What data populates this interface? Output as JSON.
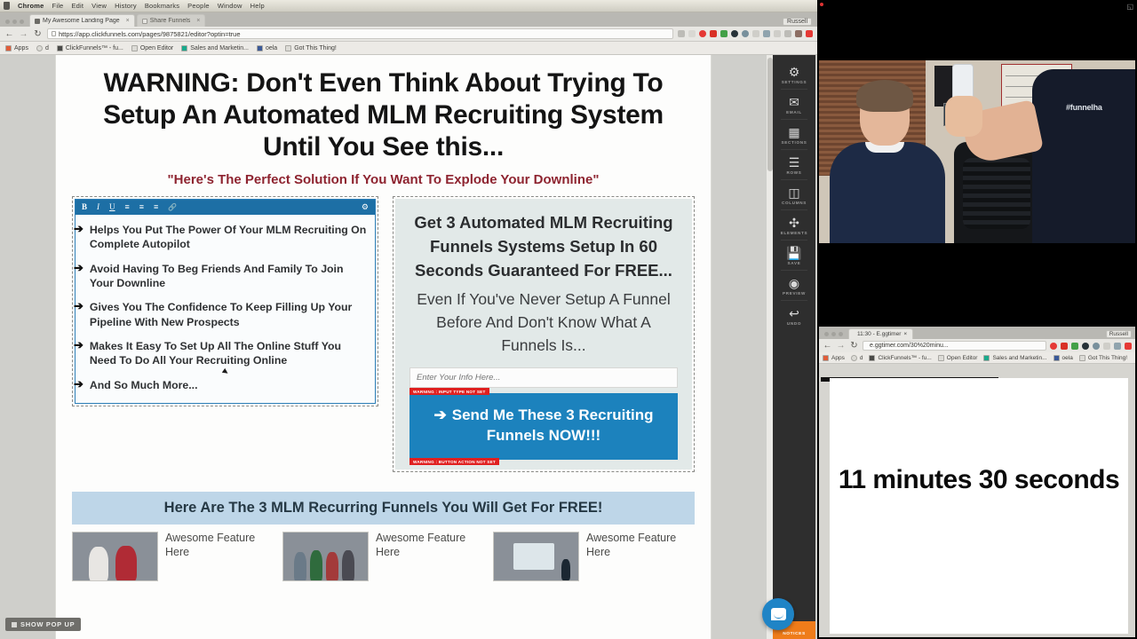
{
  "os_menubar": {
    "items": [
      "Chrome",
      "File",
      "Edit",
      "View",
      "History",
      "Bookmarks",
      "People",
      "Window",
      "Help"
    ]
  },
  "browser": {
    "tabs": [
      {
        "label": "My Awesome Landing Page",
        "active": true
      },
      {
        "label": "Share Funnels",
        "active": false
      }
    ],
    "profile_name": "Russell",
    "url": "https://app.clickfunnels.com/pages/9875821/editor?optin=true",
    "url_scheme": "https://",
    "url_rest": "app.clickfunnels.com/pages/9875821/editor?optin=true",
    "bookmarks": [
      "Apps",
      "d",
      "ClickFunnels™ - fu...",
      "Open Editor",
      "Sales and Marketin...",
      "oela",
      "Got This Thing!"
    ]
  },
  "page": {
    "headline": "WARNING:  Don't Even Think About Trying To Setup An Automated MLM Recruiting System Until You See this...",
    "subheadline": "\"Here's The Perfect Solution If You Want To Explode Your Downline\"",
    "text_toolbar": {
      "bold": "B",
      "italic": "I",
      "underline": "U",
      "align_left": "≡",
      "align_center": "≡",
      "align_right": "≡",
      "link": "🔗",
      "settings": "⚙"
    },
    "bullets": [
      "Helps You Put The Power Of Your MLM Recruiting On Complete Autopilot",
      "Avoid Having To Beg Friends And Family To Join Your Downline",
      "Gives You The Confidence To Keep Filling Up Your Pipeline With New Prospects",
      "Makes It Easy To Set Up All The Online Stuff You Need To Do All Your Recruiting Online",
      "And So Much More..."
    ],
    "bullet_marker": "➔",
    "optin": {
      "headline": "Get 3 Automated MLM Recruiting Funnels Systems Setup In 60 Seconds Guaranteed For FREE...",
      "subheadline": "Even If You've Never Setup A Funnel Before And Don't Know What A Funnels Is...",
      "input_placeholder": "Enter Your Info Here...",
      "input_value": "",
      "input_warning": "WARNING : INPUT TYPE NOT SET",
      "cta_arrow": "➔",
      "cta_label": "Send Me These 3 Recruiting Funnels NOW!!!",
      "cta_warning": "WARNING : BUTTON ACTION NOT SET",
      "cta_color": "#1c82bd",
      "warning_color": "#e02020"
    },
    "band_title": "Here Are The 3 MLM Recurring Funnels You Will Get For FREE!",
    "features": [
      {
        "title": "Awesome Feature Here"
      },
      {
        "title": "Awesome Feature Here"
      },
      {
        "title": "Awesome Feature Here"
      }
    ],
    "show_popup_label": "SHOW POP UP"
  },
  "editor_rail": {
    "items": [
      {
        "label": "SETTINGS",
        "icon": "⚙",
        "icon_name": "gear-icon"
      },
      {
        "label": "EMAIL",
        "icon": "✉",
        "icon_name": "envelope-icon"
      },
      {
        "label": "SECTIONS",
        "icon": "▤",
        "icon_name": "cube-icon"
      },
      {
        "label": "ROWS",
        "icon": "☰",
        "icon_name": "rows-icon"
      },
      {
        "label": "COLUMNS",
        "icon": "▥",
        "icon_name": "columns-icon"
      },
      {
        "label": "ELEMENTS",
        "icon": "✣",
        "icon_name": "elements-icon"
      },
      {
        "label": "SAVE",
        "icon": "Ὃe",
        "icon_name": "floppy-disk-icon"
      },
      {
        "label": "PREVIEW",
        "icon": "◉",
        "icon_name": "eye-icon"
      },
      {
        "label": "UNDO",
        "icon": "↩",
        "icon_name": "undo-arrow-icon"
      }
    ],
    "notices_label": "NOTICES",
    "notices_color": "#ef7c1a",
    "chat_icon": "intercom-chat-icon"
  },
  "webcam": {
    "shirt_text": "#funnelha",
    "recording": true
  },
  "timer_window": {
    "tab_label": "11:30 - E.ggtimer",
    "url": "e.ggtimer.com/30%20minu...",
    "profile_name": "Russell",
    "bookmarks": [
      "Apps",
      "d",
      "ClickFunnels™ - fu...",
      "Open Editor",
      "Sales and Marketin...",
      "oela",
      "Got This Thing!"
    ],
    "timer_text": "11 minutes 30 seconds"
  }
}
